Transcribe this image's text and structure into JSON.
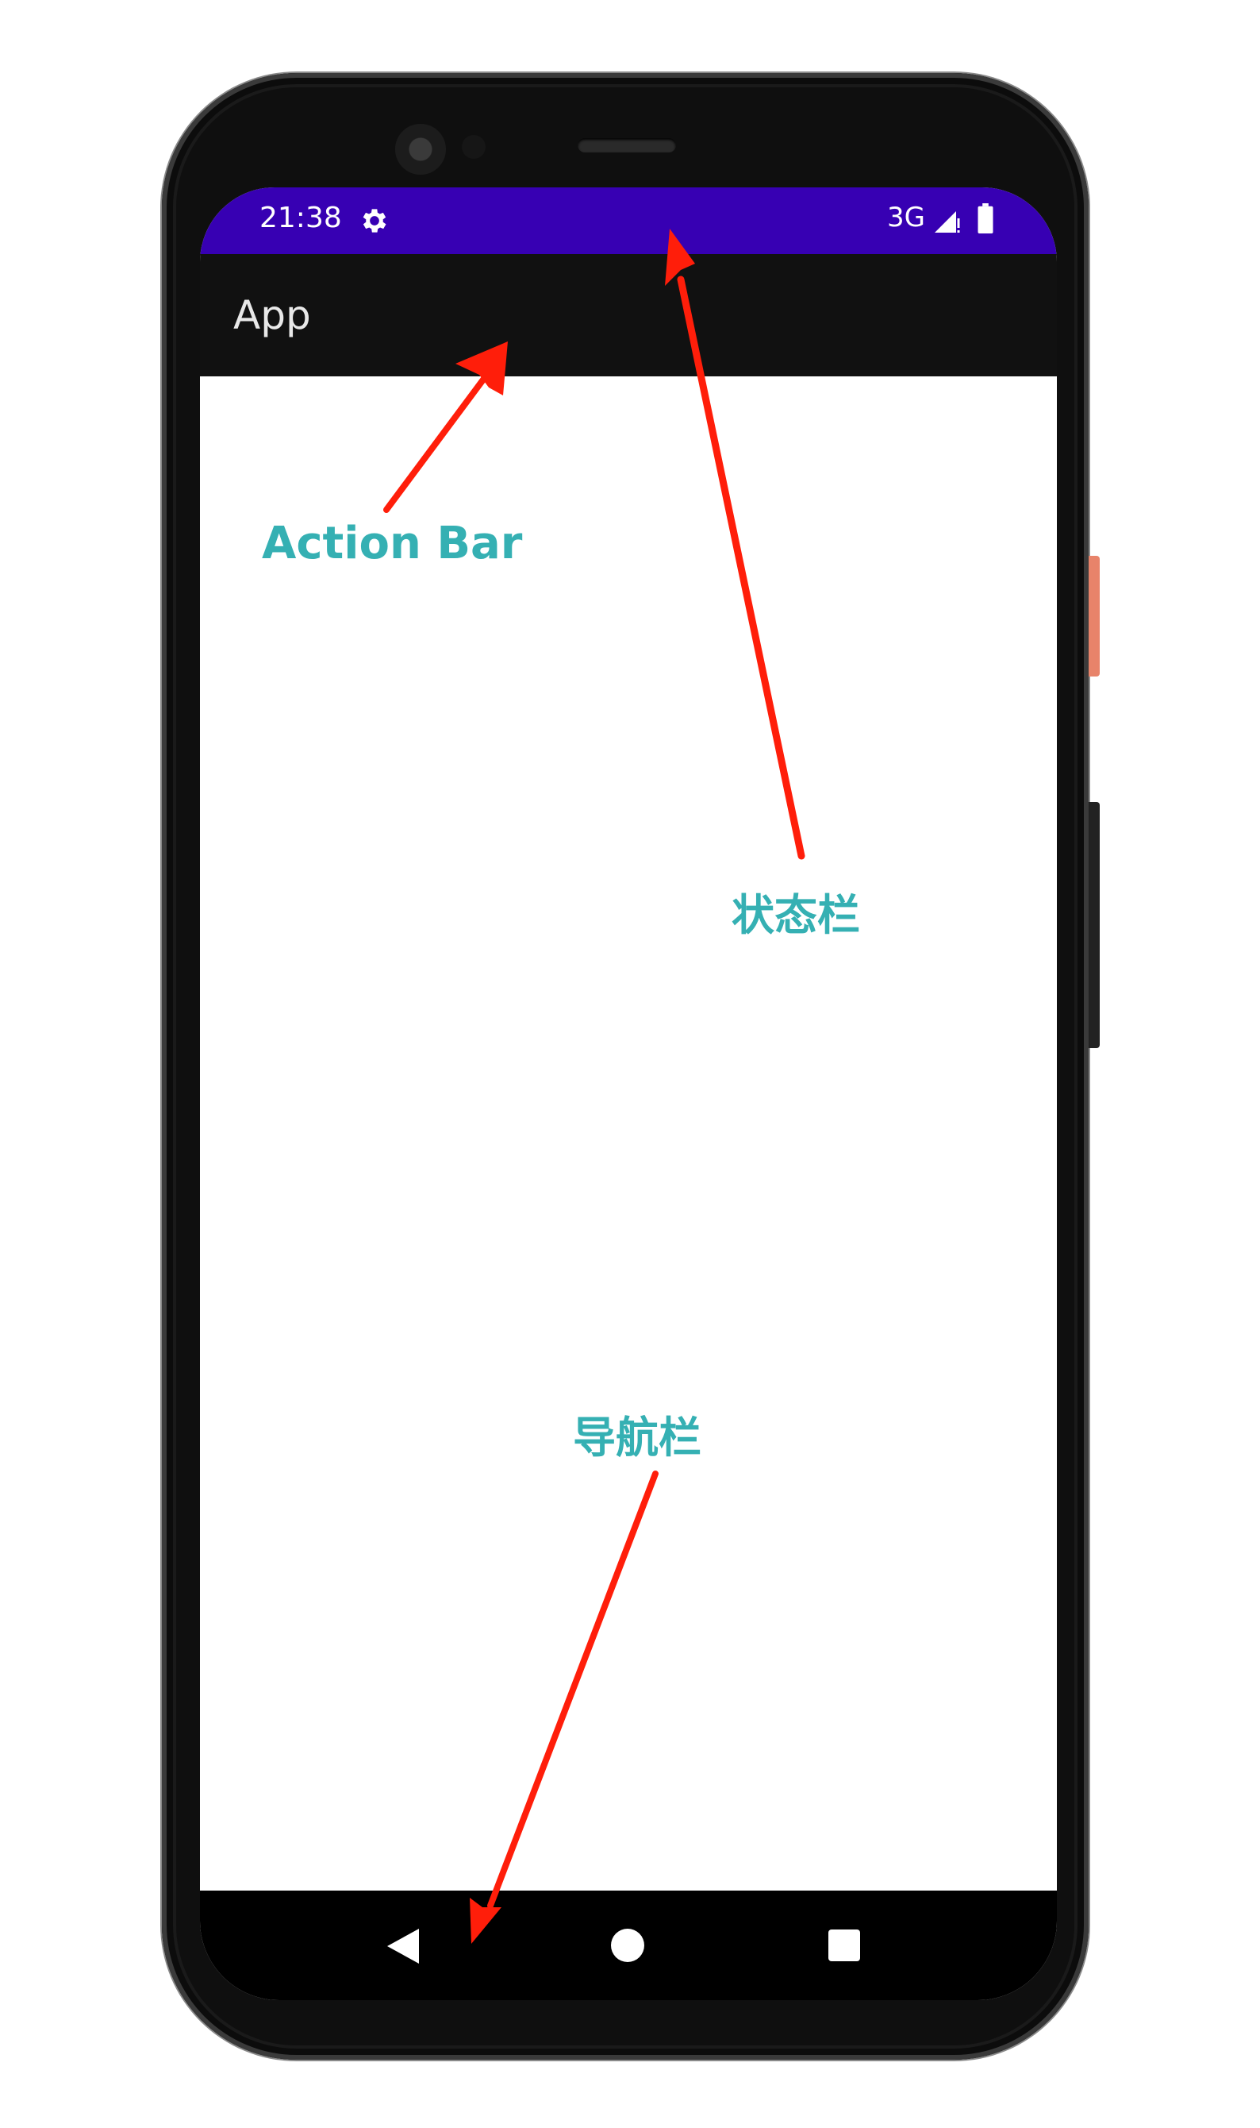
{
  "status_bar": {
    "time": "21:38",
    "network": "3G",
    "settings_icon": "gear-icon",
    "signal_icon": "cell-signal-icon",
    "battery_icon": "battery-icon",
    "color": "#3700b3"
  },
  "action_bar": {
    "title": "App",
    "color": "#111111"
  },
  "nav_bar": {
    "back_icon": "back-triangle-icon",
    "home_icon": "home-circle-icon",
    "recents_icon": "recents-square-icon",
    "color": "#000000"
  },
  "annotations": {
    "action_bar_label": "Action Bar",
    "status_bar_label": "状态栏",
    "nav_bar_label": "导航栏",
    "label_color": "#35b0b3",
    "arrow_color": "#ff1e0a"
  }
}
